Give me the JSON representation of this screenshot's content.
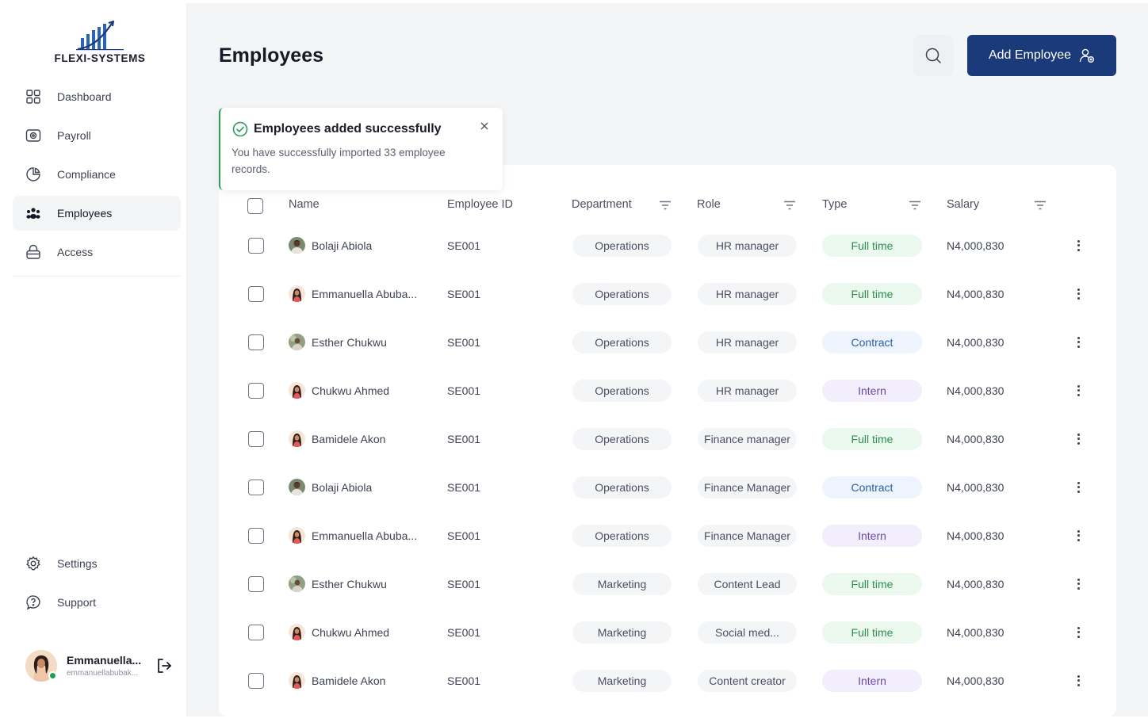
{
  "brand": {
    "name": "FLEXI-SYSTEMS"
  },
  "colors": {
    "primary": "#1b3a7a",
    "success": "#2e9a5c",
    "full_time_bg": "#eaf8ee",
    "full_time_fg": "#2f8f4f",
    "contract_bg": "#eef4fd",
    "contract_fg": "#2a5fa8",
    "intern_bg": "#f2eefb",
    "intern_fg": "#6b4aa8"
  },
  "sidebar": {
    "items": [
      {
        "label": "Dashboard",
        "icon": "grid-icon"
      },
      {
        "label": "Payroll",
        "icon": "camera-icon"
      },
      {
        "label": "Compliance",
        "icon": "pie-chart-icon"
      },
      {
        "label": "Employees",
        "icon": "people-icon",
        "active": true
      },
      {
        "label": "Access",
        "icon": "lock-icon"
      }
    ],
    "bottom_items": [
      {
        "label": "Settings",
        "icon": "gear-icon"
      },
      {
        "label": "Support",
        "icon": "help-chat-icon"
      }
    ],
    "user": {
      "name": "Emmanuella...",
      "email": "emmanuellabubak..."
    }
  },
  "header": {
    "title": "Employees",
    "add_label": "Add Employee"
  },
  "toast": {
    "title": "Employees added successfully",
    "message": "You have successfully imported 33 employee records."
  },
  "table": {
    "columns": {
      "name": "Name",
      "id": "Employee ID",
      "department": "Department",
      "role": "Role",
      "type": "Type",
      "salary": "Salary"
    },
    "rows": [
      {
        "name": "Bolaji Abiola",
        "id": "SE001",
        "department": "Operations",
        "role": "HR manager",
        "type": "Full time",
        "salary": "N4,000,830",
        "avatar": "m"
      },
      {
        "name": "Emmanuella Abuba...",
        "id": "SE001",
        "department": "Operations",
        "role": "HR manager",
        "type": "Full time",
        "salary": "N4,000,830",
        "avatar": "f"
      },
      {
        "name": "Esther Chukwu",
        "id": "SE001",
        "department": "Operations",
        "role": "HR manager",
        "type": "Contract",
        "salary": "N4,000,830",
        "avatar": "o"
      },
      {
        "name": "Chukwu Ahmed",
        "id": "SE001",
        "department": "Operations",
        "role": "HR manager",
        "type": "Intern",
        "salary": "N4,000,830",
        "avatar": "f"
      },
      {
        "name": "Bamidele Akon",
        "id": "SE001",
        "department": "Operations",
        "role": "Finance manager",
        "type": "Full time",
        "salary": "N4,000,830",
        "avatar": "f"
      },
      {
        "name": "Bolaji Abiola",
        "id": "SE001",
        "department": "Operations",
        "role": "Finance Manager",
        "type": "Contract",
        "salary": "N4,000,830",
        "avatar": "m"
      },
      {
        "name": "Emmanuella Abuba...",
        "id": "SE001",
        "department": "Operations",
        "role": "Finance Manager",
        "type": "Intern",
        "salary": "N4,000,830",
        "avatar": "f"
      },
      {
        "name": "Esther Chukwu",
        "id": "SE001",
        "department": "Marketing",
        "role": "Content Lead",
        "type": "Full time",
        "salary": "N4,000,830",
        "avatar": "o"
      },
      {
        "name": "Chukwu Ahmed",
        "id": "SE001",
        "department": "Marketing",
        "role": "Social med...",
        "type": "Full time",
        "salary": "N4,000,830",
        "avatar": "f"
      },
      {
        "name": "Bamidele Akon",
        "id": "SE001",
        "department": "Marketing",
        "role": "Content creator",
        "type": "Intern",
        "salary": "N4,000,830",
        "avatar": "f"
      }
    ]
  }
}
